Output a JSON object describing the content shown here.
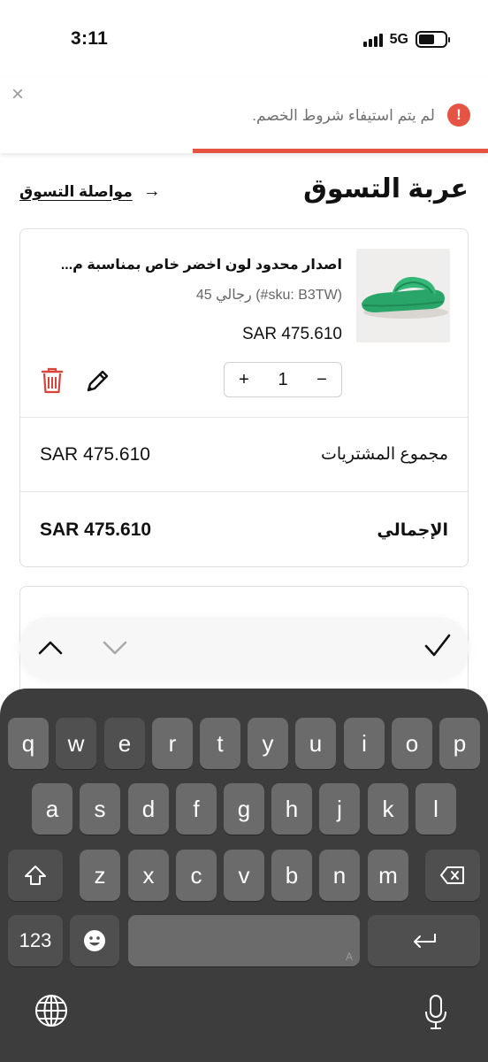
{
  "status_bar": {
    "time": "3:11",
    "network": "5G"
  },
  "alert": {
    "message": "لم يتم استيفاء شروط الخصم.",
    "close_glyph": "×",
    "icon_glyph": "!"
  },
  "header": {
    "title": "عربة التسوق",
    "continue_label": "مواصلة التسوق",
    "arrow_glyph": "→"
  },
  "cart_item": {
    "name": "اصدار محدود لون اخضر خاص بمناسبة م...",
    "meta": "45 رجالي (#sku: B3TW)",
    "price": "SAR 475.610",
    "quantity": "1",
    "plus_glyph": "+",
    "minus_glyph": "−",
    "image_icon": "green-slide-sandal-image"
  },
  "summary": {
    "subtotal_label": "مجموع المشتريات",
    "subtotal_value": "SAR 475.610",
    "total_label": "الإجمالي",
    "total_value": "SAR 475.610"
  },
  "keyboard": {
    "row1": [
      "q",
      "w",
      "e",
      "r",
      "t",
      "y",
      "u",
      "i",
      "o",
      "p"
    ],
    "row2": [
      "a",
      "s",
      "d",
      "f",
      "g",
      "h",
      "j",
      "k",
      "l"
    ],
    "row3": [
      "z",
      "x",
      "c",
      "v",
      "b",
      "n",
      "m"
    ],
    "numbers_label": "123",
    "space_corner": "A"
  },
  "colors": {
    "accent": "#e55342",
    "keyboard_bg": "#3d3d3d",
    "key_bg": "#6b6b6b",
    "delete_icon": "#d9433a"
  }
}
